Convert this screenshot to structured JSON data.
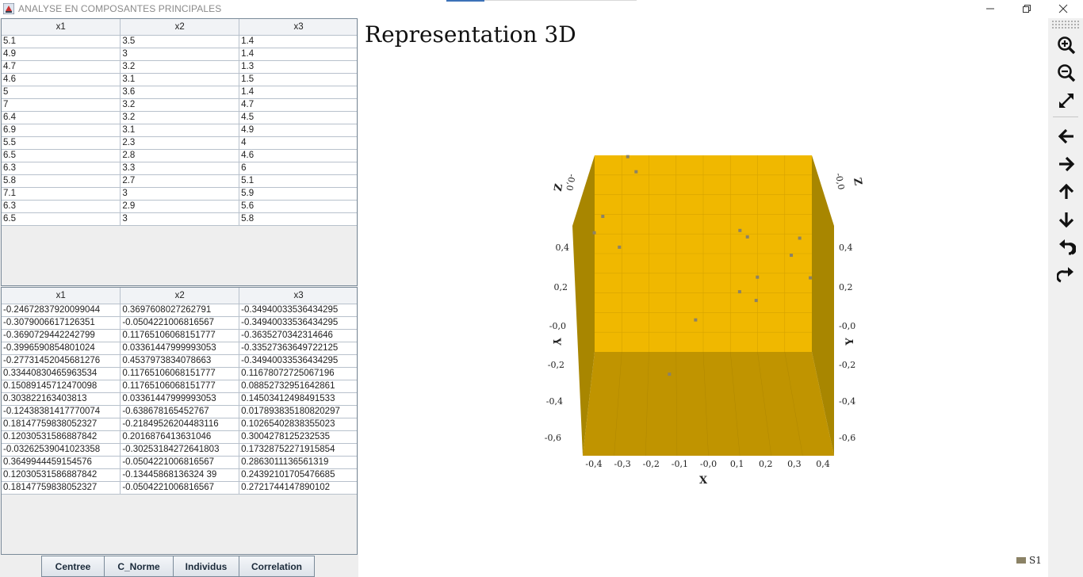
{
  "window": {
    "title": "ANALYSE EN COMPOSANTES PRINCIPALES",
    "icon": "java-app-icon"
  },
  "table_top": {
    "columns": [
      "x1",
      "x2",
      "x3"
    ],
    "rows": [
      [
        "5.1",
        "3.5",
        "1.4"
      ],
      [
        "4.9",
        "3",
        "1.4"
      ],
      [
        "4.7",
        "3.2",
        "1.3"
      ],
      [
        "4.6",
        "3.1",
        "1.5"
      ],
      [
        "5",
        "3.6",
        "1.4"
      ],
      [
        "7",
        "3.2",
        "4.7"
      ],
      [
        "6.4",
        "3.2",
        "4.5"
      ],
      [
        "6.9",
        "3.1",
        "4.9"
      ],
      [
        "5.5",
        "2.3",
        "4"
      ],
      [
        "6.5",
        "2.8",
        "4.6"
      ],
      [
        "6.3",
        "3.3",
        "6"
      ],
      [
        "5.8",
        "2.7",
        "5.1"
      ],
      [
        "7.1",
        "3",
        "5.9"
      ],
      [
        "6.3",
        "2.9",
        "5.6"
      ],
      [
        "6.5",
        "3",
        "5.8"
      ]
    ]
  },
  "table_bottom": {
    "columns": [
      "x1",
      "x2",
      "x3"
    ],
    "rows": [
      [
        "-0.24672837920099044",
        "0.3697608027262791",
        "-0.34940033536434295"
      ],
      [
        "-0.3079006617126351",
        "-0.0504221006816567",
        "-0.34940033536434295"
      ],
      [
        "-0.3690729442242799",
        "0.11765106068151777",
        "-0.363527034231464​6"
      ],
      [
        "-0.3996590854801024",
        "0.03361447999993053",
        "-0.33527363649722125"
      ],
      [
        "-0.27731452045681276",
        "0.4537973834078663",
        "-0.34940033536434295"
      ],
      [
        "0.33440830465963534",
        "0.11765106068151777",
        "0.11678072725067196"
      ],
      [
        "0.15089145712470098",
        "0.11765106068151777",
        "0.08852732951642861"
      ],
      [
        "0.303822163403813",
        "0.03361447999993053",
        "0.14503412498491533"
      ],
      [
        "-0.12438381417770074",
        "-0.638678165452767",
        "0.017893835180820297"
      ],
      [
        "0.18147759838052327",
        "-0.21849526204483116",
        "0.10265402838355023"
      ],
      [
        "0.12030531586887842",
        "0.2016876413631046",
        "0.3004278125232535"
      ],
      [
        "-0.03262539041023358",
        "-0.30253184272641803",
        "0.17328752271915854"
      ],
      [
        "0.3649944459154576",
        "-0.0504221006816567",
        "0.2863011136561319"
      ],
      [
        "0.12030531586887842",
        "-0.13445868136324 39",
        "0.24392101705476685"
      ],
      [
        "0.18147759838052327",
        "-0.0504221006816567",
        "0.2721744147890102"
      ]
    ]
  },
  "buttons": {
    "centree": "Centree",
    "cnorme": "C_Norme",
    "individus": "Individus",
    "correlation": "Correlation"
  },
  "chart_title": "Representation 3D",
  "chart_data": {
    "type": "scatter",
    "title": "Representation 3D",
    "xlabel": "X",
    "ylabel": "Y",
    "zlabel": "Z",
    "x_ticks": [
      "-0,4",
      "-0,3",
      "-0,2",
      "-0,1",
      "-0,0",
      "0,1",
      "0,2",
      "0,3",
      "0,4"
    ],
    "y_ticks": [
      "0,4",
      "0,2",
      "-0,0",
      "-0,2",
      "-0,4",
      "-0,6"
    ],
    "z_ticks": [
      "-0,0"
    ],
    "xlim": [
      -0.4,
      0.4
    ],
    "ylim": [
      -0.65,
      0.45
    ],
    "grid": true,
    "wall_color": "#f0b800",
    "side_color": "#b89200",
    "floor_color": "#c99a00",
    "series": [
      {
        "name": "S1",
        "color": "#8b8266",
        "x": [
          -0.2467,
          -0.3079,
          -0.3691,
          -0.3997,
          -0.2773,
          0.3344,
          0.1509,
          0.3038,
          -0.1244,
          0.1815,
          0.1203,
          -0.0326,
          0.365,
          0.1203,
          0.1815
        ],
        "y": [
          0.3698,
          -0.0504,
          0.1177,
          0.0336,
          0.4538,
          0.1177,
          0.1177,
          0.0336,
          -0.6387,
          -0.2185,
          0.2017,
          -0.3025,
          -0.0504,
          -0.1345,
          -0.0504
        ],
        "z": [
          -0.3494,
          -0.3494,
          -0.3635,
          -0.3353,
          -0.3494,
          0.1168,
          0.0885,
          0.145,
          0.0179,
          0.1027,
          0.3004,
          0.1733,
          0.2863,
          0.2439,
          0.2722
        ]
      }
    ]
  },
  "toolbar": {
    "items": [
      "zoom-in-icon",
      "zoom-out-icon",
      "fit-icon",
      "arrow-left-icon",
      "arrow-right-icon",
      "arrow-up-icon",
      "arrow-down-icon",
      "undo-icon",
      "redo-icon"
    ]
  },
  "legend": {
    "label": "S1"
  }
}
